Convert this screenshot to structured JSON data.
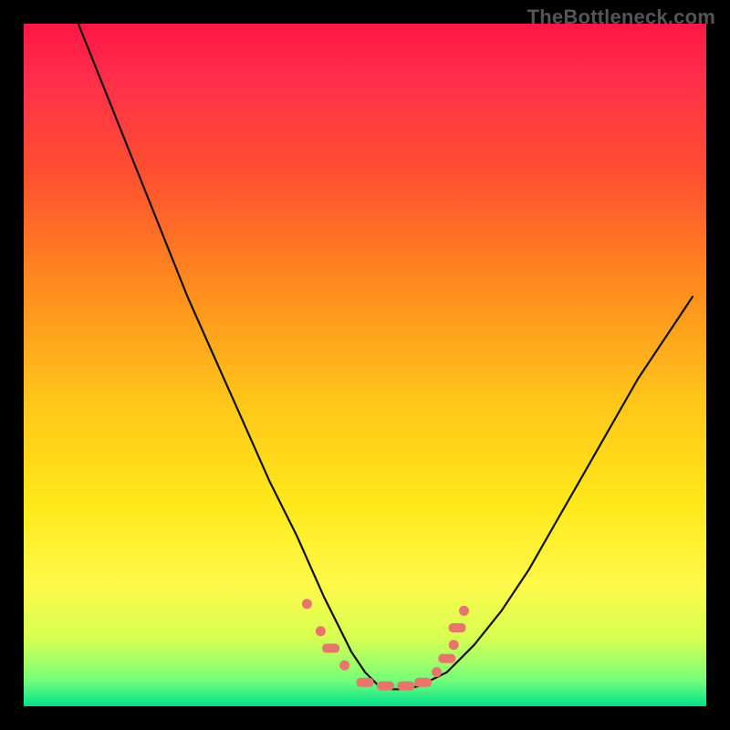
{
  "watermark": "TheBottleneck.com",
  "colors": {
    "frame": "#000000",
    "curve": "#111111",
    "marker": "#e8756b",
    "gradient_stops": [
      "#ff1744",
      "#ff5030",
      "#ffc51a",
      "#fff94a",
      "#00e28c"
    ]
  },
  "chart_data": {
    "type": "line",
    "title": "",
    "xlabel": "",
    "ylabel": "",
    "xlim": [
      0,
      100
    ],
    "ylim": [
      0,
      100
    ],
    "note": "Axes are unlabeled in the image. x/y normalized to 0–100 of the visible gradient square; y = 0 is the bottom (green) edge, y = 100 is the top (red) edge.",
    "series": [
      {
        "name": "bottleneck-curve",
        "x": [
          8,
          12,
          16,
          20,
          24,
          28,
          32,
          36,
          40,
          44,
          46,
          48,
          50,
          52,
          54,
          56,
          58,
          62,
          66,
          70,
          74,
          78,
          82,
          86,
          90,
          94,
          98
        ],
        "y": [
          100,
          90,
          80,
          70,
          60,
          51,
          42,
          33,
          25,
          16,
          12,
          8,
          5,
          3,
          2.5,
          2.5,
          3,
          5,
          9,
          14,
          20,
          27,
          34,
          41,
          48,
          54,
          60
        ]
      }
    ],
    "markers": {
      "note": "Salmon dots/pills near the curve's trough and shoulders (visual emphasis, not data labels).",
      "points": [
        {
          "x": 41.5,
          "y": 15.0,
          "shape": "dot"
        },
        {
          "x": 43.5,
          "y": 11.0,
          "shape": "dot"
        },
        {
          "x": 45.0,
          "y": 8.5,
          "shape": "pill"
        },
        {
          "x": 47.0,
          "y": 6.0,
          "shape": "dot"
        },
        {
          "x": 50.0,
          "y": 3.5,
          "shape": "pill"
        },
        {
          "x": 53.0,
          "y": 3.0,
          "shape": "pill"
        },
        {
          "x": 56.0,
          "y": 3.0,
          "shape": "pill"
        },
        {
          "x": 58.5,
          "y": 3.5,
          "shape": "pill"
        },
        {
          "x": 60.5,
          "y": 5.0,
          "shape": "dot"
        },
        {
          "x": 62.0,
          "y": 7.0,
          "shape": "pill"
        },
        {
          "x": 63.0,
          "y": 9.0,
          "shape": "dot"
        },
        {
          "x": 63.5,
          "y": 11.5,
          "shape": "pill"
        },
        {
          "x": 64.5,
          "y": 14.0,
          "shape": "dot"
        }
      ]
    }
  }
}
